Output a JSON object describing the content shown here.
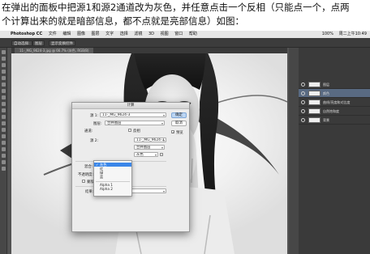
{
  "caption": {
    "line1": "在弹出的面板中把源1和源2通道改为灰色，并任意点击一个反相（只能点一个，点两",
    "line2": "个计算出来的就是暗部信息，都不点就是亮部信息）如图："
  },
  "menubar": {
    "app": "Photoshop CC",
    "menus": [
      "文件",
      "编辑",
      "图像",
      "图层",
      "文字",
      "选择",
      "滤镜",
      "3D",
      "视图",
      "窗口",
      "帮助"
    ],
    "status": [
      "100%",
      "周二上午10:49"
    ]
  },
  "optbar": {
    "items": [
      "自动选择:",
      "图层",
      "显示变换控件"
    ]
  },
  "doc_tab": "11-_MG_9624-3.jpg @ 66.7% (灰色, RGB/8)",
  "layers": [
    {
      "name": "图层"
    },
    {
      "name": "颜色"
    },
    {
      "name": "曲线/亮度和对比度"
    },
    {
      "name": "自然饱和度"
    },
    {
      "name": "背景"
    }
  ],
  "dialog": {
    "title": "计算",
    "source1_label": "源 1:",
    "source1_value": "11-_MG_9624-3",
    "layer_label": "图层:",
    "layer_value": "合并图层",
    "channel_label": "通道:",
    "channel_value": "灰色",
    "invert_label": "反相",
    "source2_label": "源 2:",
    "source2_value": "11-_MG_9624-3",
    "blend_label": "混合:",
    "blend_value": "正片叠底",
    "opacity_label": "不透明度:",
    "opacity_value": "100",
    "opacity_unit": "%",
    "mask_label": "蒙版...",
    "result_label": "结果:",
    "result_value": "新建通道",
    "ok_label": "确定",
    "cancel_label": "取消",
    "preview_label": "预览",
    "preview_checked": true,
    "channel_options": [
      "灰色",
      "红",
      "绿",
      "蓝",
      "Alpha 1",
      "Alpha 2"
    ],
    "channel_selected": "灰色"
  }
}
